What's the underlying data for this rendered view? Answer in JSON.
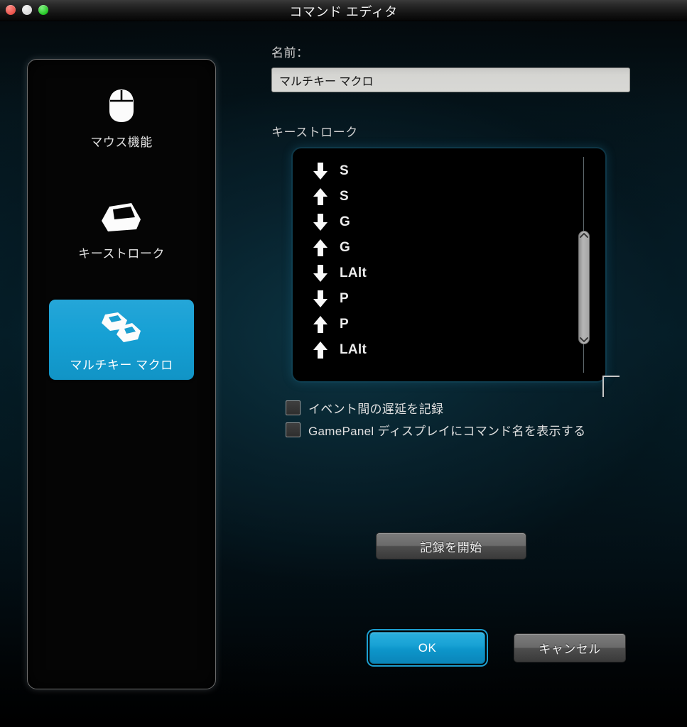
{
  "window": {
    "title": "コマンド エディタ",
    "controls": [
      {
        "name": "close",
        "color": "#e8524a"
      },
      {
        "name": "minimize",
        "color": "#d9d9d9"
      },
      {
        "name": "maximize",
        "color": "#24c524"
      }
    ]
  },
  "sidebar": {
    "items": [
      {
        "label": "マウス機能",
        "icon": "mouse-icon",
        "selected": false
      },
      {
        "label": "キーストローク",
        "icon": "keycap-icon",
        "selected": false
      },
      {
        "label": "マルチキー マクロ",
        "icon": "multi-keycap-icon",
        "selected": true
      }
    ]
  },
  "main": {
    "name_label": "名前：",
    "name_value": "マルチキー マクロ",
    "name_placeholder": "名前",
    "keystroke_label": "キーストローク",
    "keystrokes": [
      {
        "direction": "down",
        "key": "S"
      },
      {
        "direction": "up",
        "key": "S"
      },
      {
        "direction": "down",
        "key": "G"
      },
      {
        "direction": "up",
        "key": "G"
      },
      {
        "direction": "down",
        "key": "LAlt"
      },
      {
        "direction": "down",
        "key": "P"
      },
      {
        "direction": "up",
        "key": "P"
      },
      {
        "direction": "up",
        "key": "LAlt"
      }
    ],
    "checkboxes": [
      {
        "label": "イベント間の遅延を記録",
        "checked": false
      },
      {
        "label": "GamePanel ディスプレイにコマンド名を表示する",
        "checked": false
      }
    ],
    "record_button": "記録を開始"
  },
  "footer": {
    "ok_label": "OK",
    "cancel_label": "キャンセル"
  },
  "colors": {
    "accent_blue": "#18a2d5",
    "selected_item_blue": "#1b9fd0",
    "panel_black": "#050505",
    "input_gray": "#d5d5d2",
    "text_light": "#e3e3e3"
  }
}
